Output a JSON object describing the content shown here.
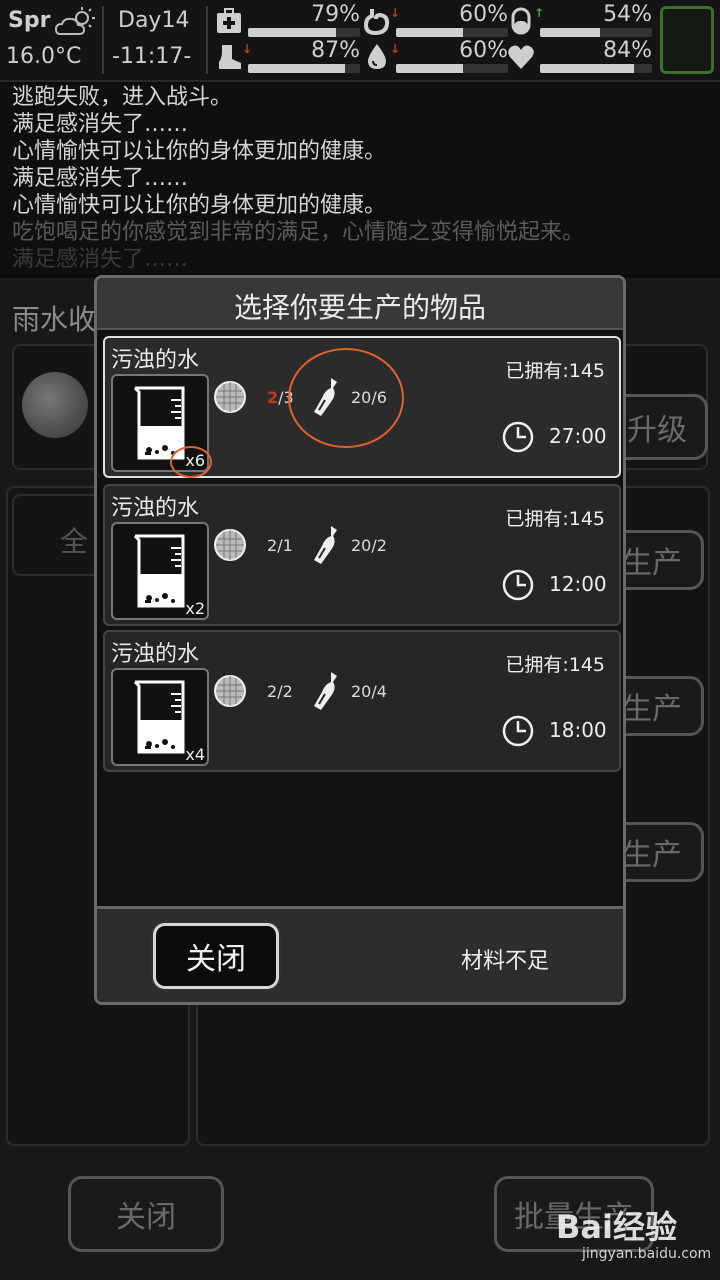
{
  "status_bar": {
    "season": "Spr",
    "temperature": "16.0°C",
    "day": "Day14",
    "time": "-11:17-",
    "stats": [
      {
        "name": "health",
        "icon": "first-aid-icon",
        "value": "79%",
        "level": 0.79,
        "trend": "",
        "trend_color": ""
      },
      {
        "name": "hunger",
        "icon": "stomach-icon",
        "value": "60%",
        "level": 0.6,
        "trend": "↓",
        "trend_color": "#c0392b"
      },
      {
        "name": "medicine",
        "icon": "pill-icon",
        "value": "54%",
        "level": 0.54,
        "trend": "↑",
        "trend_color": "#3fa34d"
      },
      {
        "name": "stamina",
        "icon": "boot-icon",
        "value": "87%",
        "level": 0.87,
        "trend": "↓",
        "trend_color": "#c0392b"
      },
      {
        "name": "thirst",
        "icon": "water-drop-icon",
        "value": "60%",
        "level": 0.6,
        "trend": "↓",
        "trend_color": "#c0392b"
      },
      {
        "name": "mood",
        "icon": "heart-icon",
        "value": "84%",
        "level": 0.84,
        "trend": "",
        "trend_color": ""
      }
    ]
  },
  "log": [
    "逃跑失败，进入战斗。",
    "满足感消失了……",
    "心情愉快可以让你的身体更加的健康。",
    "满足感消失了……",
    "心情愉快可以让你的身体更加的健康。",
    "吃饱喝足的你感觉到非常的满足，心情随之变得愉悦起来。",
    "满足感消失了……"
  ],
  "background": {
    "title": "雨水收",
    "upgrade_label": "升级",
    "produce_label": "生产",
    "all_label": "全",
    "close_label": "关闭",
    "batch_label": "批量生产"
  },
  "modal": {
    "title": "选择你要生产的物品",
    "items": [
      {
        "name": "污浊的水",
        "qty": "x6",
        "mat1_have": "2",
        "mat1_need": "/3",
        "mat2": "20/6",
        "owned": "已拥有:145",
        "time": "27:00"
      },
      {
        "name": "污浊的水",
        "qty": "x2",
        "mat1_have": "2",
        "mat1_need": "/1",
        "mat2": "20/2",
        "owned": "已拥有:145",
        "time": "12:00"
      },
      {
        "name": "污浊的水",
        "qty": "x4",
        "mat1_have": "2",
        "mat1_need": "/2",
        "mat2": "20/4",
        "owned": "已拥有:145",
        "time": "18:00"
      }
    ],
    "close_label": "关闭",
    "status": "材料不足"
  },
  "watermark": {
    "brand": "Bai经验",
    "url": "jingyan.baidu.com"
  }
}
